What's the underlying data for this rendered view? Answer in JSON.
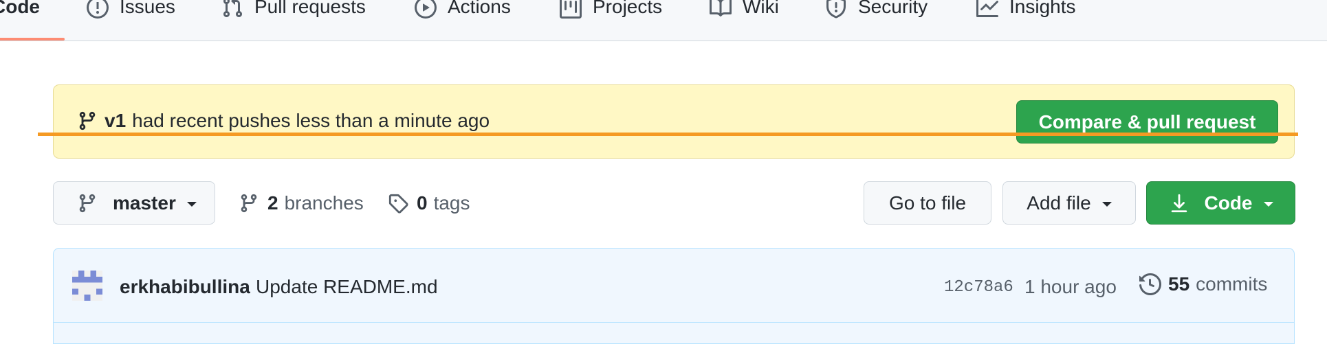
{
  "nav": {
    "tabs": [
      {
        "label": "Code",
        "icon": "code-icon",
        "active": true
      },
      {
        "label": "Issues",
        "icon": "issue-opened-icon"
      },
      {
        "label": "Pull requests",
        "icon": "git-pull-request-icon"
      },
      {
        "label": "Actions",
        "icon": "play-icon"
      },
      {
        "label": "Projects",
        "icon": "table-icon"
      },
      {
        "label": "Wiki",
        "icon": "book-icon"
      },
      {
        "label": "Security",
        "icon": "shield-icon"
      },
      {
        "label": "Insights",
        "icon": "graph-icon"
      }
    ],
    "active_underline_color": "#fd8c73"
  },
  "banner": {
    "branch": "v1",
    "message": "had recent pushes less than a minute ago",
    "button_label": "Compare & pull request",
    "background": "#fff8c5"
  },
  "toolbar": {
    "branch_name": "master",
    "branches_count": "2",
    "branches_word": "branches",
    "tags_count": "0",
    "tags_word": "tags",
    "goto_label": "Go to file",
    "add_label": "Add file",
    "code_label": "Code",
    "primary_color": "#2da44e"
  },
  "commit": {
    "author": "erkhabibullina",
    "message": "Update README.md",
    "sha": "12c78a6",
    "time": "1 hour ago",
    "count": "55",
    "count_word": "commits"
  }
}
